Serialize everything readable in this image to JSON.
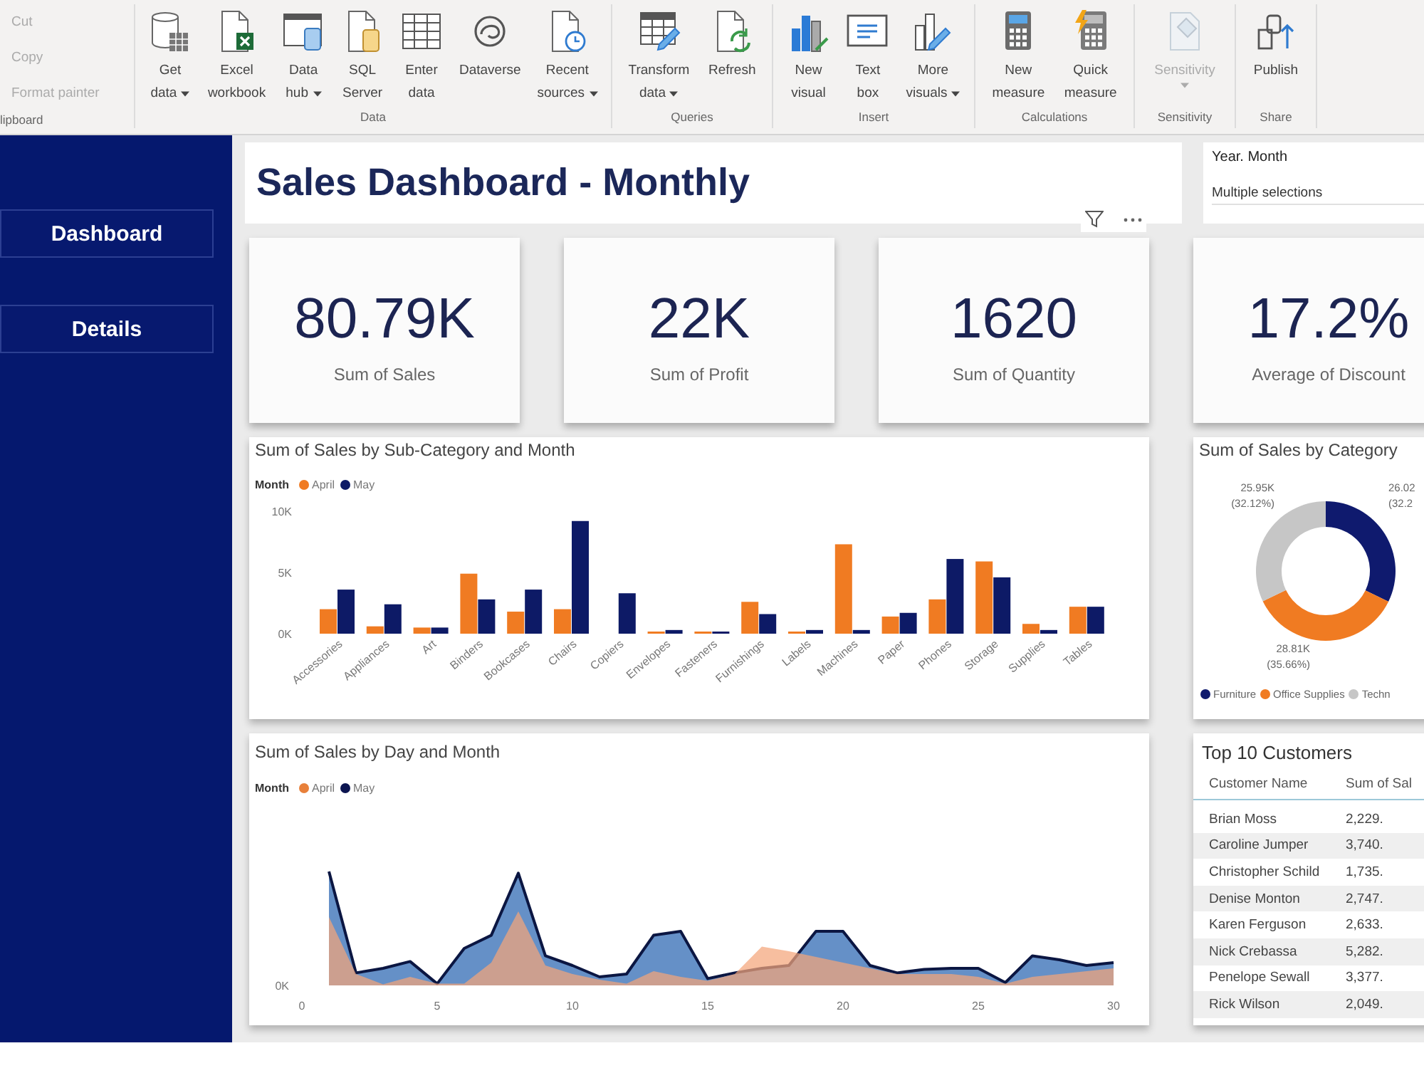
{
  "ribbon": {
    "groups": [
      {
        "label": "lipboard",
        "kind": "small",
        "items": [
          {
            "label": "Cut",
            "disabled": true
          },
          {
            "label": "Copy",
            "disabled": true
          },
          {
            "label": "Format painter",
            "disabled": true
          }
        ]
      },
      {
        "label": "Data",
        "kind": "large",
        "items": [
          {
            "kind": "getdata",
            "lines": [
              "Get",
              "data"
            ],
            "dropdown": true,
            "disabled": false
          },
          {
            "kind": "excel",
            "lines": [
              "Excel",
              "workbook"
            ],
            "dropdown": false,
            "disabled": false
          },
          {
            "kind": "datahub",
            "lines": [
              "Data",
              "hub"
            ],
            "dropdown": true,
            "disabled": false
          },
          {
            "kind": "sql",
            "lines": [
              "SQL",
              "Server"
            ],
            "dropdown": false,
            "disabled": false
          },
          {
            "kind": "enterdata",
            "lines": [
              "Enter",
              "data"
            ],
            "dropdown": false,
            "disabled": false
          },
          {
            "kind": "dataverse",
            "lines": [
              "Dataverse"
            ],
            "dropdown": false,
            "disabled": false
          },
          {
            "kind": "recent",
            "lines": [
              "Recent",
              "sources"
            ],
            "dropdown": true,
            "disabled": false
          }
        ]
      },
      {
        "label": "Queries",
        "kind": "large",
        "items": [
          {
            "kind": "transform",
            "lines": [
              "Transform",
              "data"
            ],
            "dropdown": true,
            "disabled": false
          },
          {
            "kind": "refresh",
            "lines": [
              "Refresh"
            ],
            "dropdown": false,
            "disabled": false
          }
        ]
      },
      {
        "label": "Insert",
        "kind": "large",
        "items": [
          {
            "kind": "newvisual",
            "lines": [
              "New",
              "visual"
            ],
            "dropdown": false,
            "disabled": false
          },
          {
            "kind": "textbox",
            "lines": [
              "Text",
              "box"
            ],
            "dropdown": false,
            "disabled": false
          },
          {
            "kind": "morevisuals",
            "lines": [
              "More",
              "visuals"
            ],
            "dropdown": true,
            "disabled": false
          }
        ]
      },
      {
        "label": "Calculations",
        "kind": "large",
        "items": [
          {
            "kind": "measure",
            "lines": [
              "New",
              "measure"
            ],
            "dropdown": false,
            "disabled": false
          },
          {
            "kind": "quickmeasure",
            "lines": [
              "Quick",
              "measure"
            ],
            "dropdown": false,
            "disabled": false
          }
        ]
      },
      {
        "label": "Sensitivity",
        "kind": "large",
        "items": [
          {
            "kind": "sensitivity",
            "lines": [
              "Sensitivity"
            ],
            "dropdown": true,
            "disabled": true
          }
        ]
      },
      {
        "label": "Share",
        "kind": "large",
        "items": [
          {
            "kind": "publish",
            "lines": [
              "Publish"
            ],
            "dropdown": false,
            "disabled": false
          }
        ]
      }
    ]
  },
  "sidebar": {
    "items": [
      {
        "label": "Dashboard"
      },
      {
        "label": "Details"
      }
    ]
  },
  "report": {
    "title": "Sales Dashboard - Monthly",
    "slicer": {
      "label": "Year. Month",
      "value": "Multiple selections"
    },
    "kpis": [
      {
        "value": "80.79K",
        "label": "Sum of Sales"
      },
      {
        "value": "22K",
        "label": "Sum of Profit"
      },
      {
        "value": "1620",
        "label": "Sum of Quantity"
      },
      {
        "value": "17.2%",
        "label": "Average of Discount"
      }
    ],
    "bar_chart": {
      "title": "Sum of Sales by Sub-Category and Month",
      "legend_title": "Month",
      "chart_data": {
        "type": "bar",
        "categories": [
          "Accessories",
          "Appliances",
          "Art",
          "Binders",
          "Bookcases",
          "Chairs",
          "Copiers",
          "Envelopes",
          "Fasteners",
          "Furnishings",
          "Labels",
          "Machines",
          "Paper",
          "Phones",
          "Storage",
          "Supplies",
          "Tables"
        ],
        "series": [
          {
            "name": "April",
            "color": "#f07b22",
            "values": [
              2000,
              600,
              500,
              4900,
              1800,
              2000,
              0,
              100,
              100,
              2600,
              100,
              7300,
              1400,
              2800,
              5900,
              800,
              2200
            ]
          },
          {
            "name": "May",
            "color": "#0d1a66",
            "values": [
              3600,
              2400,
              500,
              2800,
              3600,
              9200,
              3300,
              300,
              100,
              1600,
              300,
              300,
              1700,
              6100,
              4600,
              300,
              2200
            ]
          }
        ],
        "ylim": [
          0,
          10000
        ],
        "yticks": [
          {
            "value": 0,
            "label": "0K"
          },
          {
            "value": 5000,
            "label": "5K"
          },
          {
            "value": 10000,
            "label": "10K"
          }
        ]
      }
    },
    "donut_chart": {
      "title": "Sum of Sales by Category",
      "chart_data": {
        "type": "donut",
        "categories": [
          "Furniture",
          "Office Supplies",
          "Techn"
        ],
        "values": [
          32.22,
          35.66,
          32.12
        ],
        "colors": [
          "#0f1a6e",
          "#f07b22",
          "#c6c6c6"
        ]
      },
      "slice_labels": [
        {
          "value": "25.95K",
          "share": "(32.12%)"
        },
        {
          "value": "26.02",
          "share": "(32.2"
        },
        {
          "value": "28.81K",
          "share": "(35.66%)"
        }
      ]
    },
    "area_chart": {
      "title": "Sum of Sales by Day and Month",
      "legend_title": "Month",
      "legend": [
        {
          "label": "April",
          "color": "#e8803a"
        },
        {
          "label": "May",
          "color": "#0c1550"
        }
      ],
      "y_ticks": [
        "0K"
      ],
      "x_ticks": [
        "0",
        "5",
        "10",
        "15",
        "20",
        "25",
        "30"
      ]
    },
    "table": {
      "title": "Top 10 Customers",
      "columns": [
        "Customer Name",
        "Sum of Sal"
      ],
      "rows": [
        [
          "Brian Moss",
          "2,229."
        ],
        [
          "Caroline Jumper",
          "3,740."
        ],
        [
          "Christopher Schild",
          "1,735."
        ],
        [
          "Denise Monton",
          "2,747."
        ],
        [
          "Karen Ferguson",
          "2,633."
        ],
        [
          "Nick Crebassa",
          "5,282."
        ],
        [
          "Penelope Sewall",
          "3,377."
        ],
        [
          "Rick Wilson",
          "2,049."
        ]
      ]
    }
  }
}
